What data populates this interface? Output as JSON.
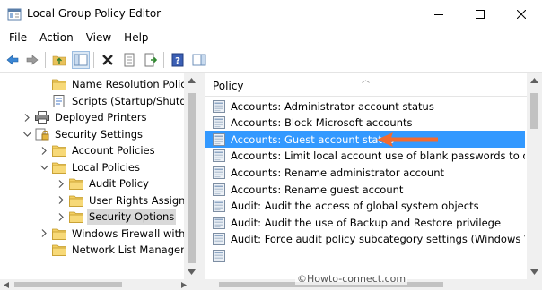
{
  "window": {
    "title": "Local Group Policy Editor"
  },
  "menu": [
    "File",
    "Action",
    "View",
    "Help"
  ],
  "tree": [
    {
      "label": "Name Resolution Policy",
      "indent": 1,
      "expander": "none",
      "selected": false,
      "icon": "folder"
    },
    {
      "label": "Scripts (Startup/Shutdown)",
      "indent": 1,
      "expander": "none",
      "selected": false,
      "icon": "script"
    },
    {
      "label": "Deployed Printers",
      "indent": 0,
      "expander": "right",
      "selected": false,
      "icon": "printer"
    },
    {
      "label": "Security Settings",
      "indent": 0,
      "expander": "down",
      "selected": false,
      "icon": "security"
    },
    {
      "label": "Account Policies",
      "indent": 1,
      "expander": "right",
      "selected": false,
      "icon": "folder"
    },
    {
      "label": "Local Policies",
      "indent": 1,
      "expander": "down",
      "selected": false,
      "icon": "folder"
    },
    {
      "label": "Audit Policy",
      "indent": 2,
      "expander": "right",
      "selected": false,
      "icon": "folder"
    },
    {
      "label": "User Rights Assignm",
      "indent": 2,
      "expander": "right",
      "selected": false,
      "icon": "folder"
    },
    {
      "label": "Security Options",
      "indent": 2,
      "expander": "right",
      "selected": true,
      "icon": "folder"
    },
    {
      "label": "Windows Firewall with A",
      "indent": 1,
      "expander": "right",
      "selected": false,
      "icon": "folder"
    },
    {
      "label": "Network List Manager P",
      "indent": 1,
      "expander": "none",
      "selected": false,
      "icon": "folder"
    }
  ],
  "policies": {
    "column": "Policy",
    "rows": [
      "Accounts: Administrator account status",
      "Accounts: Block Microsoft accounts",
      "Accounts: Guest account status",
      "Accounts: Limit local account use of blank passwords to co...",
      "Accounts: Rename administrator account",
      "Accounts: Rename guest account",
      "Audit: Audit the access of global system objects",
      "Audit: Audit the use of Backup and Restore privilege",
      "Audit: Force audit policy subcategory settings (Windows Vis...",
      ""
    ],
    "highlighted_index": 2
  },
  "watermark": "©Howto-connect.com",
  "colors": {
    "selection": "#3399ff",
    "arrow": "#f26b30",
    "tree_selected": "#d9d9d9"
  }
}
